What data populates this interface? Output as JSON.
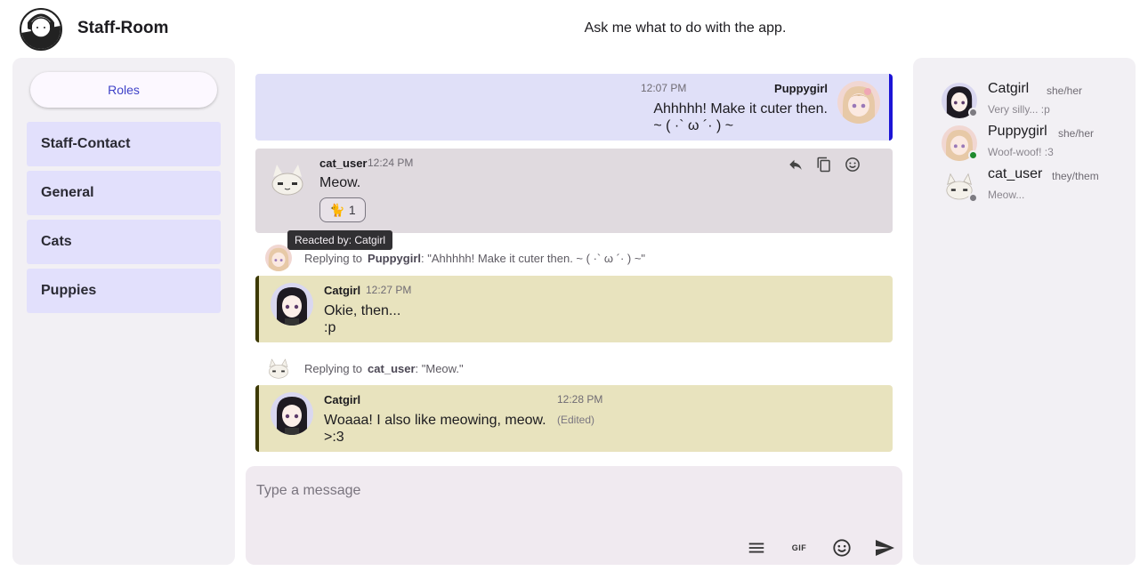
{
  "header": {
    "title": "Staff-Room",
    "assistant_prompt": "Ask me what to do with the app."
  },
  "sidebar": {
    "roles_label": "Roles",
    "channels": [
      "Staff-Contact",
      "General",
      "Cats",
      "Puppies"
    ]
  },
  "messages": [
    {
      "author": "Puppygirl",
      "time": "12:07 PM",
      "lines": [
        "Ahhhhh! Make it cuter then.",
        "~ ( ·` ω ´· ) ~"
      ]
    },
    {
      "author": "cat_user",
      "time": "12:24 PM",
      "lines": [
        "Meow."
      ],
      "reaction": {
        "emoji": "🐈",
        "count": "1"
      },
      "reaction_tooltip": "Reacted by: Catgirl"
    },
    {
      "reply_label": "Replying to",
      "reply_author": "Puppygirl",
      "reply_text": ": \"Ahhhhh! Make it cuter then. ~ ( ·` ω ´· ) ~\"",
      "author": "Catgirl",
      "time": "12:27 PM",
      "lines": [
        "Okie, then...",
        ":p"
      ]
    },
    {
      "reply_label": "Replying to",
      "reply_author": "cat_user",
      "reply_text": ": \"Meow.\"",
      "author": "Catgirl",
      "time": "12:28 PM",
      "edited": "(Edited)",
      "lines": [
        "Woaaa! I also like meowing, meow.",
        ">:3"
      ]
    }
  ],
  "composer": {
    "placeholder": "Type a message",
    "gif_label": "GIF"
  },
  "members": [
    {
      "name": "Catgirl",
      "pronouns": "she/her",
      "status": "Very silly... :p",
      "presence_color": "#7d7b81"
    },
    {
      "name": "Puppygirl",
      "pronouns": "she/her",
      "status": "Woof-woof! :3",
      "presence_color": "#1e8a2e"
    },
    {
      "name": "cat_user",
      "pronouns": "they/them",
      "status": "Meow...",
      "presence_color": "#7d7b81"
    }
  ],
  "colors": {
    "accent": "#3f42c8",
    "self_message_border": "#1c14d6",
    "reply_message_border": "#3d3a05"
  }
}
